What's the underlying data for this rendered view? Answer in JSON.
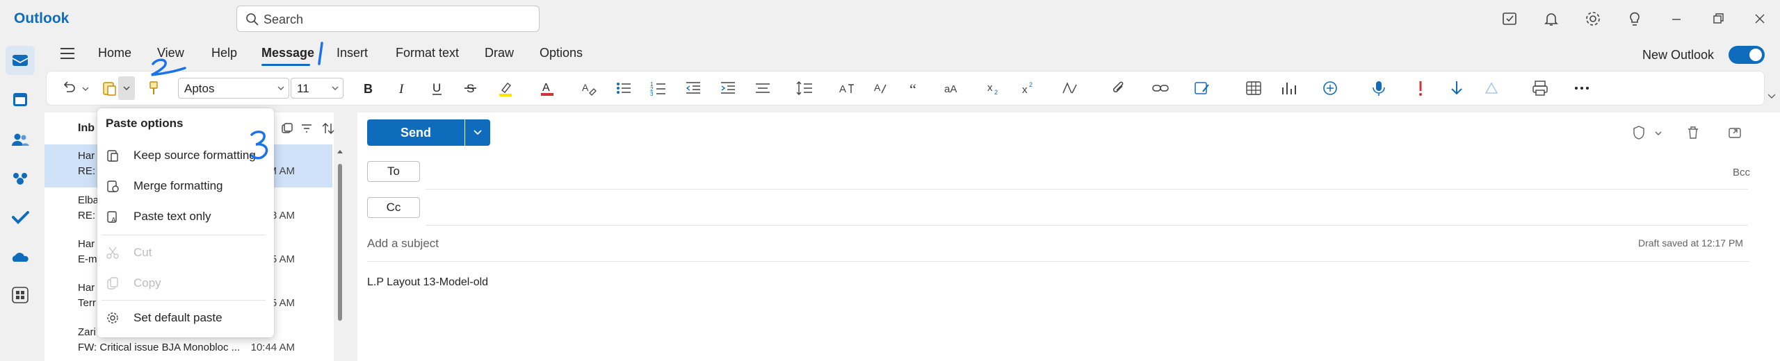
{
  "app": {
    "title": "Outlook"
  },
  "search": {
    "placeholder": "Search"
  },
  "menu_tabs": [
    {
      "label": "Home"
    },
    {
      "label": "View"
    },
    {
      "label": "Help"
    },
    {
      "label": "Message"
    },
    {
      "label": "Insert"
    },
    {
      "label": "Format text"
    },
    {
      "label": "Draw"
    },
    {
      "label": "Options"
    }
  ],
  "new_outlook": {
    "label": "New Outlook",
    "enabled": true
  },
  "ribbon": {
    "font_name": "Aptos",
    "font_size": "11"
  },
  "message_list": {
    "title": "Inb",
    "rows": [
      {
        "name": "Har",
        "preview": "RE:",
        "time": "M AM",
        "selected": true
      },
      {
        "name": "Elba",
        "preview": "RE:",
        "time": "8 AM",
        "selected": false
      },
      {
        "name": "Har",
        "preview": "E-m",
        "time": "5 AM",
        "selected": false
      },
      {
        "name": "Har",
        "preview": "Terr",
        "time": "5 AM",
        "selected": false
      },
      {
        "name": "Zari",
        "preview": "FW: Critical issue BJA Monobloc ...",
        "time": "10:44 AM",
        "selected": false
      }
    ]
  },
  "paste_menu": {
    "header": "Paste options",
    "items": [
      {
        "label": "Keep source formatting",
        "icon": "clipboard-icon",
        "disabled": false
      },
      {
        "label": "Merge formatting",
        "icon": "merge-format-icon",
        "disabled": false
      },
      {
        "label": "Paste text only",
        "icon": "text-only-icon",
        "disabled": false
      },
      {
        "label": "Cut",
        "icon": "scissors-icon",
        "disabled": true
      },
      {
        "label": "Copy",
        "icon": "copy-icon",
        "disabled": true
      },
      {
        "label": "Set default paste",
        "icon": "gear-icon",
        "disabled": false
      }
    ]
  },
  "compose": {
    "send_label": "Send",
    "to_label": "To",
    "cc_label": "Cc",
    "bcc_label": "Bcc",
    "subject_placeholder": "Add a subject",
    "draft_status": "Draft saved at 12:17 PM",
    "body": "L.P Layout 13-Model-old"
  },
  "colors": {
    "accent": "#0f6cbd",
    "selected_row": "#cfe1f7",
    "annotation": "#1a73e8"
  }
}
